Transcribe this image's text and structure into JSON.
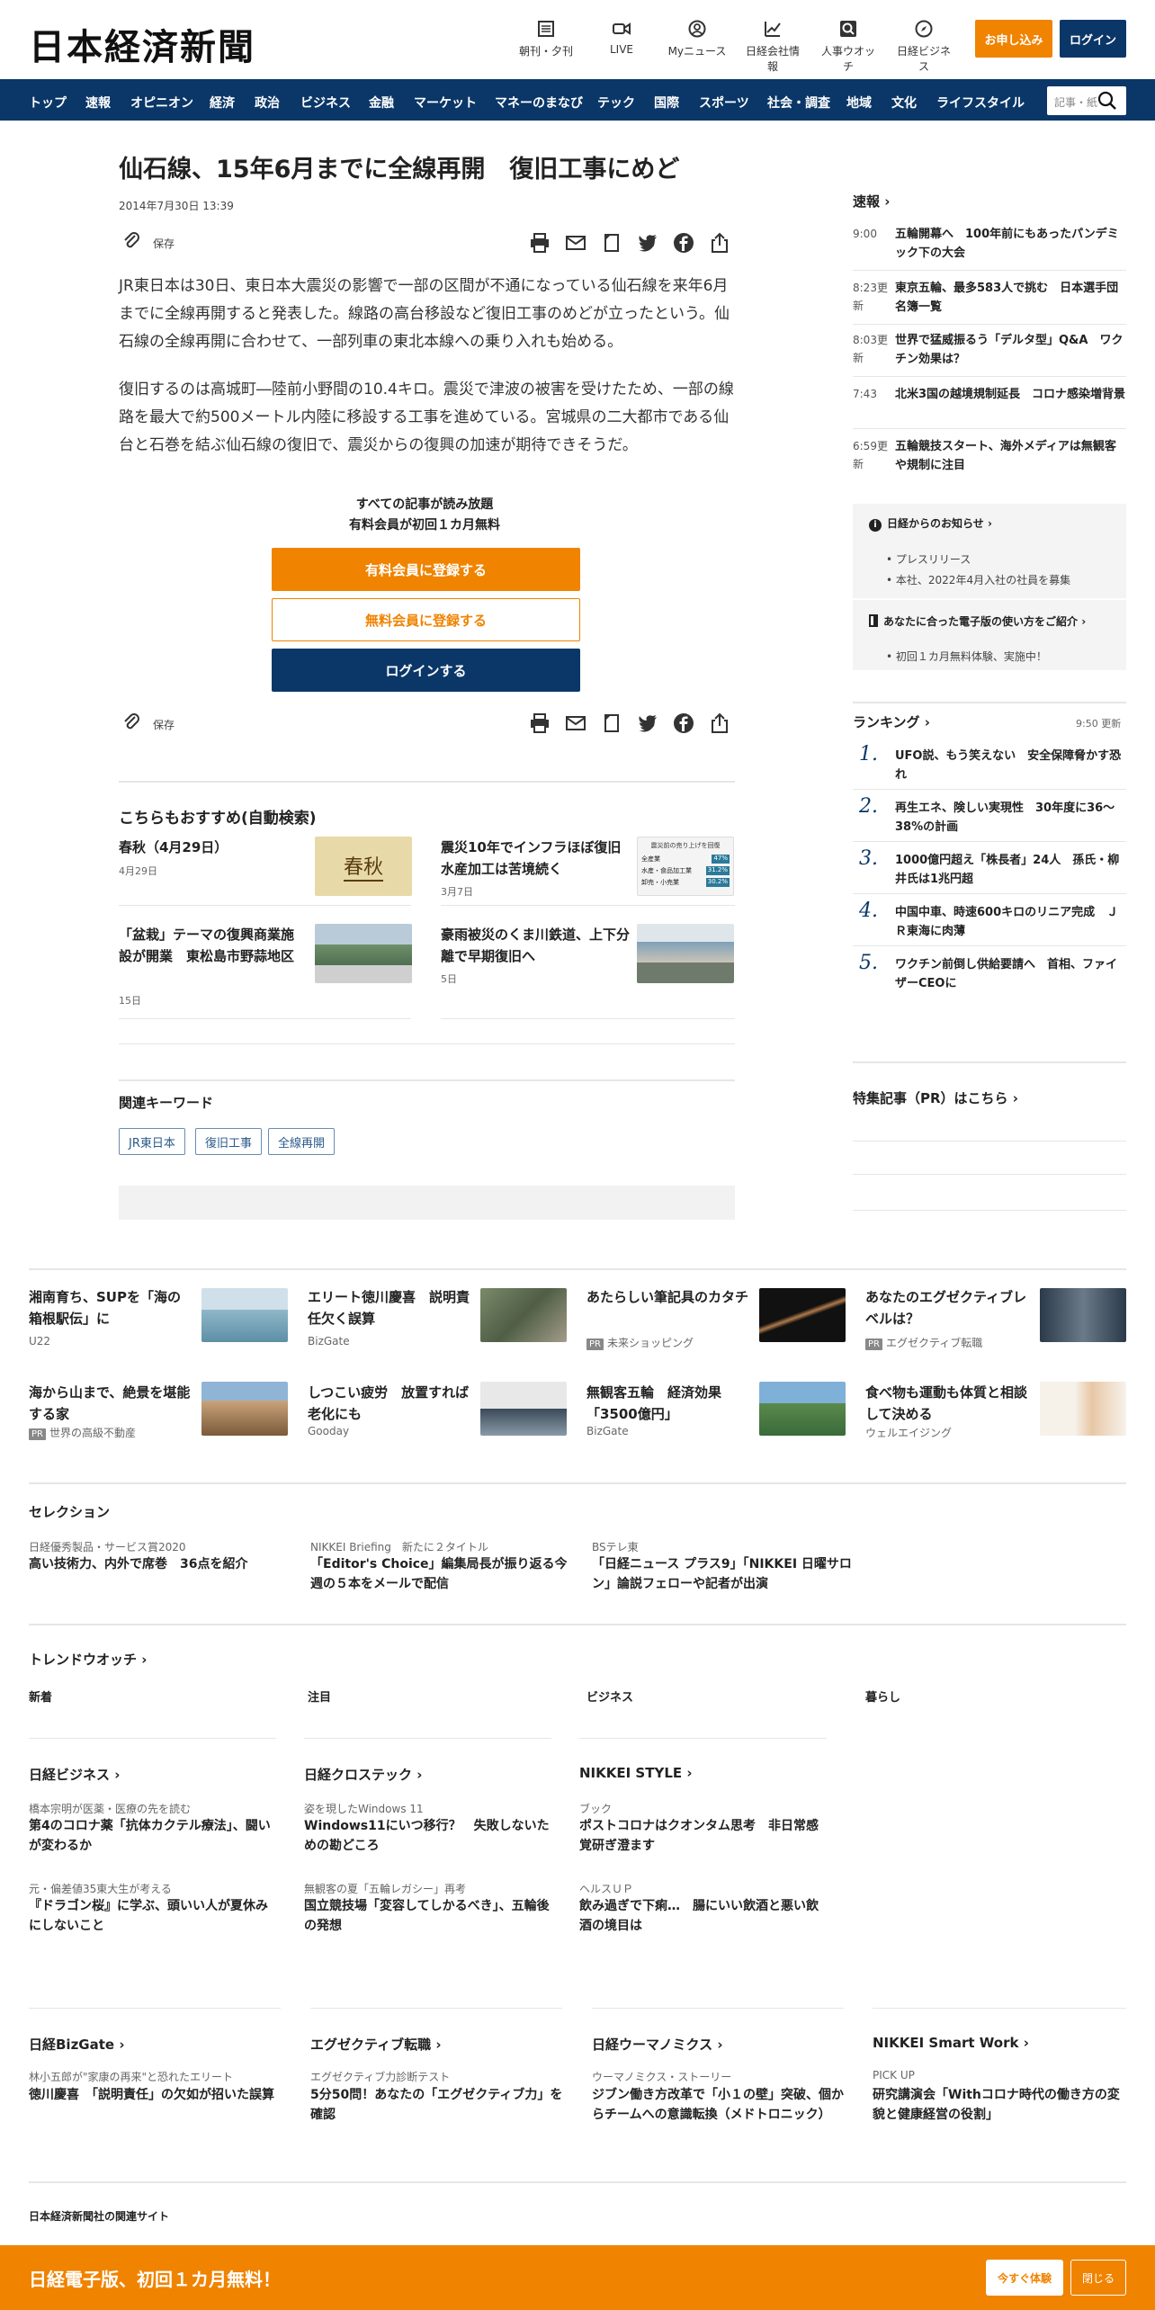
{
  "header": {
    "logo": "日本経済新聞",
    "icons": [
      {
        "label": "朝刊・夕刊",
        "icon": "newspaper-icon"
      },
      {
        "label": "LIVE",
        "icon": "video-icon"
      },
      {
        "label": "Myニュース",
        "icon": "user-icon"
      },
      {
        "label": "日経会社情報",
        "icon": "chart-icon"
      },
      {
        "label": "人事ウオッチ",
        "icon": "search-icon"
      },
      {
        "label": "日経ビジネス",
        "icon": "compass-icon"
      }
    ],
    "subscribe": "お申し込み",
    "login": "ログイン"
  },
  "nav": {
    "items": [
      "トップ",
      "速報",
      "オピニオン",
      "経済",
      "政治",
      "ビジネス",
      "金融",
      "マーケット",
      "マネーのまなび",
      "テック",
      "国際",
      "スポーツ",
      "社会・調査",
      "地域",
      "文化",
      "ライフスタイル"
    ],
    "search_placeholder": "記事・紙"
  },
  "article": {
    "title": "仙石線、15年6月までに全線再開　復旧工事にめど",
    "date": "2014年7月30日 13:39",
    "save": "保存",
    "p1": "JR東日本は30日、東日本大震災の影響で一部の区間が不通になっている仙石線を来年6月までに全線再開すると発表した。線路の高台移設など復旧工事のめどが立ったという。仙石線の全線再開に合わせて、一部列車の東北本線への乗り入れも始める。",
    "p2": "復旧するのは高城町―陸前小野間の10.4キロ。震災で津波の被害を受けたため、一部の線路を最大で約500メートル内陸に移設する工事を進めている。宮城県の二大都市である仙台と石巻を結ぶ仙石線の復旧で、震災からの復興の加速が期待できそうだ。"
  },
  "paywall": {
    "line1": "すべての記事が読み放題",
    "line2": "有料会員が初回１カ月無料",
    "paid": "有料会員に登録する",
    "free": "無料会員に登録する",
    "login": "ログインする"
  },
  "recommend": {
    "heading": "こちらもおすすめ(自動検索)",
    "items": [
      {
        "title": "春秋（4月29日）",
        "date": "4月29日"
      },
      {
        "title": "震災10年でインフラほぼ復旧　水産加工は苦境続く",
        "date": "3月7日"
      },
      {
        "title": "「盆栽」テーマの復興商業施設が開業　東松島市野蒜地区",
        "date": "15日"
      },
      {
        "title": "豪雨被災のくま川鉄道、上下分離で早期復旧へ",
        "date": "5日"
      }
    ],
    "thumb1_text": "春秋",
    "chart_thumb": {
      "title": "震災前の売り上げを回復",
      "rows": [
        {
          "label": "全産業",
          "value": "47%"
        },
        {
          "label": "水産・食品加工業",
          "value": "31.2%"
        },
        {
          "label": "卸売・小売業",
          "value": "30.2%"
        }
      ]
    }
  },
  "keywords": {
    "heading": "関連キーワード",
    "items": [
      "JR東日本",
      "復旧工事",
      "全線再開"
    ]
  },
  "sidebar": {
    "sokuho": "速報",
    "news": [
      {
        "time": "9:00",
        "title": "五輪開幕へ　100年前にもあったパンデミック下の大会"
      },
      {
        "time": "8:23更新",
        "title": "東京五輪、最多583人で挑む　日本選手団名簿一覧"
      },
      {
        "time": "8:03更新",
        "title": "世界で猛威振るう「デルタ型」Q&A　ワクチン効果は？"
      },
      {
        "time": "7:43",
        "title": "北米3国の越境規制延長　コロナ感染増背景"
      },
      {
        "time": "6:59更新",
        "title": "五輪競技スタート、海外メディアは無観客や規制に注目"
      }
    ],
    "notice": {
      "heading": "日経からのお知らせ",
      "items": [
        "プレスリリース",
        "本社、2022年4月入社の社員を募集"
      ],
      "heading2": "あなたに合った電子版の使い方をご紹介",
      "items2": [
        "初回１カ月無料体験、実施中！"
      ]
    },
    "ranking": {
      "heading": "ランキング",
      "time": "9:50 更新",
      "items": [
        {
          "n": "1.",
          "title": "UFO説、もう笑えない　安全保障脅かす恐れ"
        },
        {
          "n": "2.",
          "title": "再生エネ、険しい実現性　30年度に36～38%の計画"
        },
        {
          "n": "3.",
          "title": "1000億円超え「株長者」24人　孫氏・柳井氏は1兆円超"
        },
        {
          "n": "4.",
          "title": "中国中車、時速600キロのリニア完成　ＪＲ東海に肉薄"
        },
        {
          "n": "5.",
          "title": "ワクチン前倒し供給要請へ　首相、ファイザーCEOに"
        }
      ]
    },
    "pr": "特集記事（PR）はこちら"
  },
  "grid": [
    {
      "title": "湘南育ち、SUPを「海の箱根駅伝」に",
      "src": "U22",
      "pr": false
    },
    {
      "title": "エリート徳川慶喜　説明責任欠く誤算",
      "src": "BizGate",
      "pr": false
    },
    {
      "title": "あたらしい筆記具のカタチ",
      "src": "未来ショッピング",
      "pr": true
    },
    {
      "title": "あなたのエグゼクティブレベルは？",
      "src": "エグゼクティブ転職",
      "pr": true
    },
    {
      "title": "海から山まで、絶景を堪能する家",
      "src": "世界の高級不動産",
      "pr": true
    },
    {
      "title": "しつこい疲労　放置すれば老化にも",
      "src": "Gooday",
      "pr": false
    },
    {
      "title": "無観客五輪　経済効果「3500億円」",
      "src": "BizGate",
      "pr": false
    },
    {
      "title": "食べ物も運動も体質と相談して決める",
      "src": "ウェルエイジング",
      "pr": false
    }
  ],
  "pr_label": "PR",
  "selection": {
    "heading": "セレクション",
    "items": [
      {
        "src": "日経優秀製品・サービス賞2020",
        "title": "高い技術力、内外で席巻　36点を紹介"
      },
      {
        "src": "NIKKEI Briefing　新たに２タイトル",
        "title": "「Editor's Choice」編集局長が振り返る今週の５本をメールで配信"
      },
      {
        "src": "BSテレ東",
        "title": "「日経ニュース プラス9」「NIKKEI 日曜サロン」論説フェローや記者が出演"
      }
    ]
  },
  "trend": {
    "heading": "トレンドウオッチ",
    "tabs": [
      "新着",
      "注目",
      "ビジネス",
      "暮らし"
    ]
  },
  "media1": [
    {
      "heading": "日経ビジネス",
      "items": [
        {
          "src": "橋本宗明が医薬・医療の先を読む",
          "title": "第4のコロナ薬「抗体カクテル療法」、闘いが変わるか"
        },
        {
          "src": "元・偏差値35東大生が考える",
          "title": "『ドラゴン桜』に学ぶ、頭いい人が夏休みにしないこと"
        }
      ]
    },
    {
      "heading": "日経クロステック",
      "items": [
        {
          "src": "姿を現したWindows 11",
          "title": "Windows11にいつ移行？　失敗しないための勘どころ"
        },
        {
          "src": "無観客の夏「五輪レガシー」再考",
          "title": "国立競技場「変容してしかるべき」、五輪後の発想"
        }
      ]
    },
    {
      "heading": "NIKKEI STYLE",
      "items": [
        {
          "src": "ブック",
          "title": "ポストコロナはクオンタム思考　非日常感覚研ぎ澄ます"
        },
        {
          "src": "ヘルスＵＰ",
          "title": "飲み過ぎで下痢…　腸にいい飲酒と悪い飲酒の境目は"
        }
      ]
    }
  ],
  "media2": [
    {
      "heading": "日経BizGate",
      "src": "林小五郎が\"家康の再来\"と恐れたエリート",
      "title": "徳川慶喜　「説明責任」の欠如が招いた誤算"
    },
    {
      "heading": "エグゼクティブ転職",
      "src": "エグゼクティブ力診断テスト",
      "title": "5分50問！あなたの「エグゼクティブ力」を確認"
    },
    {
      "heading": "日経ウーマノミクス",
      "src": "ウーマノミクス・ストーリー",
      "title": "ジブン働き方改革で「小１の壁」突破、個からチームへの意識転換（メドトロニック）"
    },
    {
      "heading": "NIKKEI Smart Work",
      "src": "PICK UP",
      "title": "研究講演会「Withコロナ時代の働き方の変貌と健康経営の役割」"
    }
  ],
  "related": {
    "heading": "日本経済新聞社の関連サイト"
  },
  "footer": {
    "text": "日経電子版、初回１カ月無料！",
    "trial": "今すぐ体験",
    "close": "閉じる"
  },
  "colors": {
    "navy": "#0b3768",
    "orange": "#f08300"
  }
}
